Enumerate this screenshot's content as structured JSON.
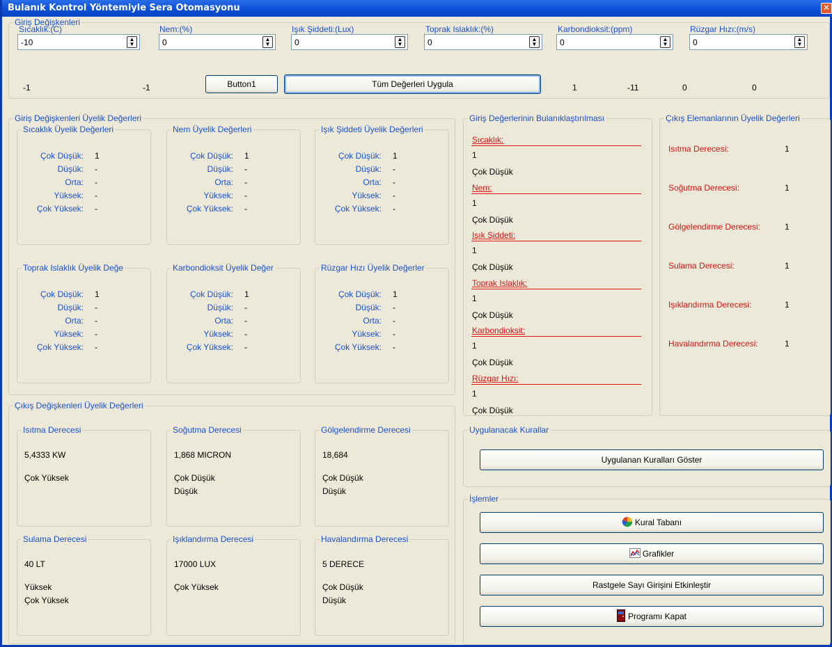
{
  "window": {
    "title": "Bulanık Kontrol Yöntemiyle Sera Otomasyonu",
    "close": "✕"
  },
  "inputs": {
    "group": "Giriş Değişkenleri",
    "fields": [
      {
        "label": "Sıcaklık:(C)",
        "value": "-10"
      },
      {
        "label": "Nem:(%)",
        "value": "0"
      },
      {
        "label": "Işık Şiddeti:(Lux)",
        "value": "0"
      },
      {
        "label": "Toprak Islaklık:(%)",
        "value": "0"
      },
      {
        "label": "Karbondioksit:(ppm)",
        "value": "0"
      },
      {
        "label": "Rüzgar Hızı:(m/s)",
        "value": "0"
      }
    ],
    "readouts": [
      "-1",
      "-1",
      "1",
      "-11",
      "0",
      "0"
    ],
    "button1": "Button1",
    "apply_all": "Tüm Değerleri Uygula"
  },
  "input_membership": {
    "group": "Giriş Değişkenleri Üyelik Değerleri",
    "row_labels": [
      "Çok Düşük:",
      "Düşük:",
      "Orta:",
      "Yüksek:",
      "Çok Yüksek:"
    ],
    "boxes": [
      {
        "title": "Sıcaklık Üyelik Değerleri",
        "values": [
          "1",
          "-",
          "-",
          "-",
          "-"
        ]
      },
      {
        "title": "Nem Üyelik Değerleri",
        "values": [
          "1",
          "-",
          "-",
          "-",
          "-"
        ]
      },
      {
        "title": "Işık Şiddeti Üyelik Değerleri",
        "values": [
          "1",
          "-",
          "-",
          "-",
          "-"
        ]
      },
      {
        "title": "Toprak Islaklık Üyelik Değe",
        "values": [
          "1",
          "-",
          "-",
          "-",
          "-"
        ]
      },
      {
        "title": "Karbondioksit Üyelik Değer",
        "values": [
          "1",
          "-",
          "-",
          "-",
          "-"
        ]
      },
      {
        "title": "Rüzgar Hızı Üyelik Değerler",
        "values": [
          "1",
          "-",
          "-",
          "-",
          "-"
        ]
      }
    ]
  },
  "fuzzification": {
    "group": "Giriş Değerlerinin Bulanıklaştırılması",
    "items": [
      {
        "name": "Sıcaklık:",
        "value": "1",
        "term": "Çok Düşük"
      },
      {
        "name": "Nem:",
        "value": "1",
        "term": "Çok Düşük"
      },
      {
        "name": "Işık Şiddeti:",
        "value": "1",
        "term": "Çok Düşük"
      },
      {
        "name": "Toprak Islaklık:",
        "value": "1",
        "term": "Çok Düşük"
      },
      {
        "name": "Karbondioksit:",
        "value": "1",
        "term": "Çok Düşük"
      },
      {
        "name": "Rüzgar Hızı:",
        "value": "1",
        "term": "Çok Düşük"
      }
    ]
  },
  "output_elements": {
    "group": "Çıkış Elemanlarının Üyelik Değerleri",
    "items": [
      {
        "label": "Isıtma Derecesi:",
        "value": "1"
      },
      {
        "label": "Soğutma Derecesi:",
        "value": "1"
      },
      {
        "label": "Gölgelendirme Derecesi:",
        "value": "1"
      },
      {
        "label": "Sulama Derecesi:",
        "value": "1"
      },
      {
        "label": "Işıklandırma Derecesi:",
        "value": "1"
      },
      {
        "label": "Havalandırma Derecesi:",
        "value": "1"
      }
    ]
  },
  "output_membership": {
    "group": "Çıkış Değişkenleri Üyelik Değerleri",
    "boxes": [
      {
        "title": "Isıtma Derecesi",
        "value": "5,4333 KW",
        "terms": [
          "Çok Yüksek"
        ]
      },
      {
        "title": "Soğutma Derecesi",
        "value": "1,868 MICRON",
        "terms": [
          "Çok Düşük",
          "Düşük"
        ]
      },
      {
        "title": "Gölgelendirme Derecesi",
        "value": "18,684",
        "terms": [
          "Çok Düşük",
          "Düşük"
        ]
      },
      {
        "title": "Sulama Derecesi",
        "value": "40 LT",
        "terms": [
          "Yüksek",
          "Çok Yüksek"
        ]
      },
      {
        "title": "Işıklandırma Derecesi",
        "value": "17000 LUX",
        "terms": [
          "Çok Yüksek"
        ]
      },
      {
        "title": "Havalandırma Derecesi",
        "value": "5 DERECE",
        "terms": [
          "Çok Düşük",
          "Düşük"
        ]
      }
    ]
  },
  "rules": {
    "group": "Uygulanacak Kurallar",
    "show_button": "Uygulanan Kuralları Göster"
  },
  "operations": {
    "group": "İşlemler",
    "buttons": [
      {
        "label": "Kural Tabanı",
        "icon": "pie-chart-icon"
      },
      {
        "label": "Grafikler",
        "icon": "line-chart-icon"
      },
      {
        "label": "Rastgele Sayı Girişini Etkinleştir",
        "icon": ""
      },
      {
        "label": "Programı Kapat",
        "icon": "door-icon"
      }
    ]
  }
}
